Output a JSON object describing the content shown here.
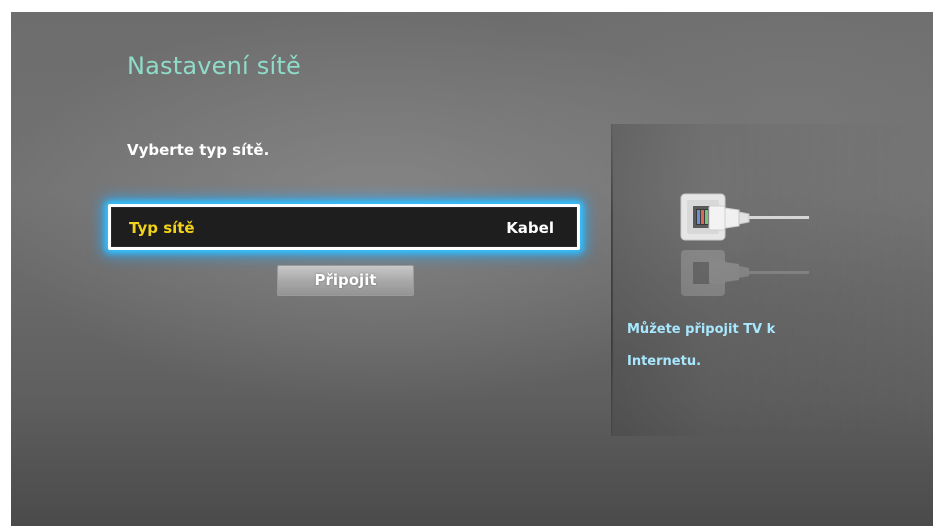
{
  "screen": {
    "title": "Nastavení sítě",
    "instruction": "Vyberte typ sítě."
  },
  "network_type": {
    "label": "Typ sítě",
    "value": "Kabel"
  },
  "buttons": {
    "connect_label": "Připojit"
  },
  "help": {
    "line1": "Můžete připojit TV k",
    "line2": "Internetu."
  },
  "icons": {
    "side_illustration": "ethernet-cable-icon"
  },
  "colors": {
    "title": "#8fdcc8",
    "field_label": "#f2d21a",
    "focus_glow": "#33c4ff",
    "help_text": "#a8e8ff"
  }
}
